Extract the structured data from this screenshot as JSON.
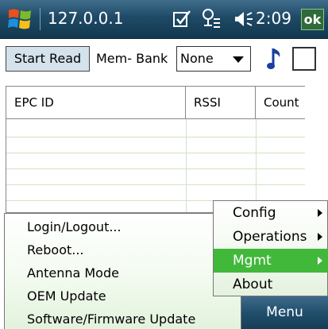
{
  "titlebar": {
    "title": "127.0.0.1",
    "time": "2:09",
    "ok_label": "ok",
    "icons": [
      "windows-start-icon",
      "sync-icon",
      "network-icon",
      "volume-icon"
    ]
  },
  "toolbar": {
    "start_read_label": "Start Read",
    "membank_label": "Mem- Bank",
    "membank_value": "None",
    "note_icon": "music-note-icon",
    "checkbox_checked": false
  },
  "table": {
    "columns": [
      "EPC ID",
      "RSSI",
      "Count"
    ]
  },
  "left_menu": {
    "items": [
      "Login/Logout...",
      "Reboot...",
      "Antenna Mode",
      "OEM Update",
      "Software/Firmware Update"
    ]
  },
  "right_menu": {
    "items": [
      "Config",
      "Operations",
      "Mgmt",
      "About"
    ],
    "selected": "Mgmt",
    "highlight_color": "#42b83a"
  },
  "softkeys": {
    "menu_label": "Menu"
  },
  "colors": {
    "titlebar": "#1f4a66",
    "menu_highlight": "#42b83a",
    "button_face": "#d4e2ec"
  }
}
